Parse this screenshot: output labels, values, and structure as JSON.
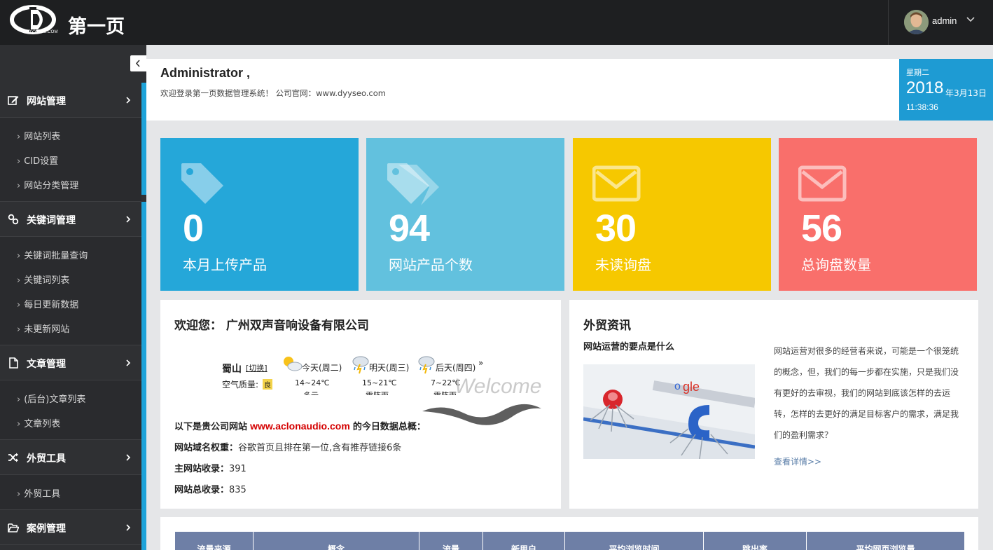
{
  "header": {
    "logo_sub": "DYYSEO.COM",
    "brand": "第一页",
    "user": "admin"
  },
  "sidebar": {
    "groups": [
      {
        "label": "网站管理",
        "icon": "edit-icon",
        "items": [
          "网站列表",
          "CID设置",
          "网站分类管理"
        ]
      },
      {
        "label": "关键词管理",
        "icon": "link-icon",
        "items": [
          "关键词批量查询",
          "关键词列表",
          "每日更新数据",
          "未更新网站"
        ]
      },
      {
        "label": "文章管理",
        "icon": "file-icon",
        "items": [
          "(后台)文章列表",
          "文章列表"
        ]
      },
      {
        "label": "外贸工具",
        "icon": "shuffle-icon",
        "items": [
          "外贸工具"
        ]
      },
      {
        "label": "案例管理",
        "icon": "folder-open-icon",
        "items": []
      }
    ]
  },
  "welcome": {
    "title": "Administrator ,",
    "text": "欢迎登录第一页数据管理系统！ 公司官网：www.dyyseo.com"
  },
  "date": {
    "weekday": "星期二",
    "year": "2018",
    "month_day": "年3月13日",
    "time": "11:38:36"
  },
  "cards": [
    {
      "value": "0",
      "label": "本月上传产品",
      "color": "#25a7d9",
      "icon": "tag-icon"
    },
    {
      "value": "94",
      "label": "网站产品个数",
      "color": "#62c1de",
      "icon": "tags-icon"
    },
    {
      "value": "30",
      "label": "未读询盘",
      "color": "#f6c800",
      "icon": "envelope-icon"
    },
    {
      "value": "56",
      "label": "总询盘数量",
      "color": "#f96f6b",
      "icon": "envelope-icon"
    }
  ],
  "company": {
    "title_prefix": "欢迎您：",
    "title_name": "广州双声音响设备有限公司",
    "weather": {
      "city": "蜀山",
      "switch": "[切换]",
      "air_label": "空气质量:",
      "air_badge": "良",
      "days": [
        {
          "name": "今天(周二)",
          "temp": "14~24℃",
          "desc": "多云"
        },
        {
          "name": "明天(周三)",
          "temp": "15~21℃",
          "desc": "雷阵雨"
        },
        {
          "name": "后天(周四)",
          "temp": "7~22℃",
          "desc": "雷阵雨"
        }
      ],
      "more": "»",
      "watermark": "Welcome"
    },
    "overview_prefix": "以下是贵公司网站",
    "site_url": "www.aclonaudio.com",
    "overview_suffix": "的今日数据总概：",
    "weight_label": "网站域名权重：",
    "weight_value": "谷歌首页且排在第一位,含有推荐链接6条",
    "main_index_label": "主网站收录：",
    "main_index_value": "391",
    "total_index_label": "网站总收录：",
    "total_index_value": "835"
  },
  "news": {
    "title": "外贸资讯",
    "headline": "网站运营的要点是什么",
    "body": "网站运营对很多的经营者来说，可能是一个很笼统的概念，但，我们的每一步都在实施，只是我们没有更好的去审视，我们的网站到底该怎样的去运转，怎样的去更好的满足目标客户的需求，满足我们的盈利需求？",
    "more": "查看详情>>"
  },
  "table": {
    "headers": [
      "流量来源",
      "概念",
      "流量",
      "新用户",
      "平均浏览时间",
      "跳出率",
      "平均网页浏览量"
    ]
  }
}
